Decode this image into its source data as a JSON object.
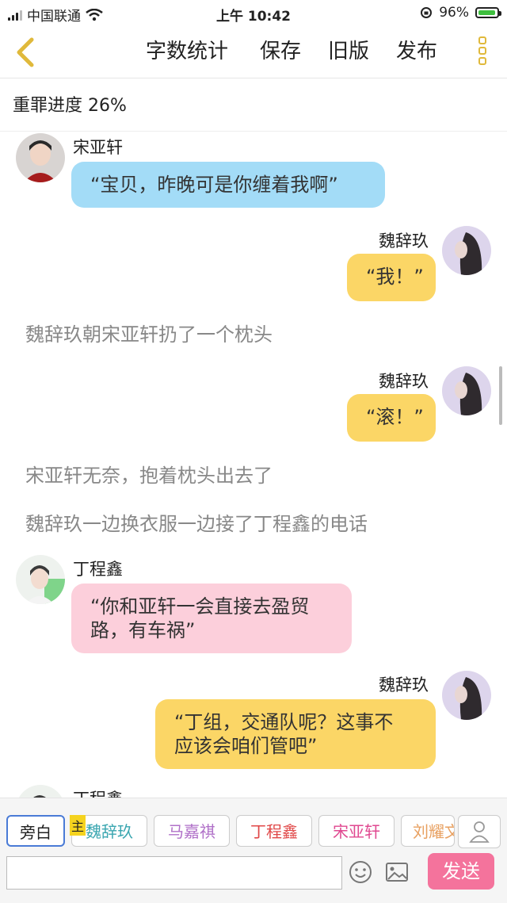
{
  "status": {
    "carrier": "中国联通",
    "time": "上午 10:42",
    "battery": "96%",
    "battery_level": 0.96
  },
  "toolbar": {
    "word_count": "字数统计",
    "save": "保存",
    "old_version": "旧版",
    "publish": "发布"
  },
  "progress": "重罪进度 26%",
  "messages": [
    {
      "type": "chat",
      "name": "宋亚轩",
      "text": "“宝贝，昨晚可是你缠着我啊”"
    },
    {
      "type": "chat",
      "name": "魏辞玖",
      "text": "“我！”"
    },
    {
      "type": "narration",
      "text": "魏辞玖朝宋亚轩扔了一个枕头"
    },
    {
      "type": "chat",
      "name": "魏辞玖",
      "text": "“滚！”"
    },
    {
      "type": "narration",
      "text": "宋亚轩无奈，抱着枕头出去了"
    },
    {
      "type": "narration",
      "text": "魏辞玖一边换衣服一边接了丁程鑫的电话"
    },
    {
      "type": "chat",
      "name": "丁程鑫",
      "line1": "“你和亚轩一会直接去盈贸",
      "line2": "路，有车祸”"
    },
    {
      "type": "chat",
      "name": "魏辞玖",
      "line1": "“丁组，交通队呢？这事不",
      "line2": "应该会咱们管吧”"
    },
    {
      "type": "chat",
      "name": "丁程鑫"
    }
  ],
  "roles": {
    "narration": "旁白",
    "host_badge": "主",
    "items": [
      {
        "label": "魏辞玖",
        "color": "#3aa6b0"
      },
      {
        "label": "马嘉祺",
        "color": "#b070c8"
      },
      {
        "label": "丁程鑫",
        "color": "#e04848"
      },
      {
        "label": "宋亚轩",
        "color": "#e04890"
      },
      {
        "label": "刘耀文",
        "color": "#e8a060"
      }
    ]
  },
  "composer": {
    "send": "发送"
  }
}
